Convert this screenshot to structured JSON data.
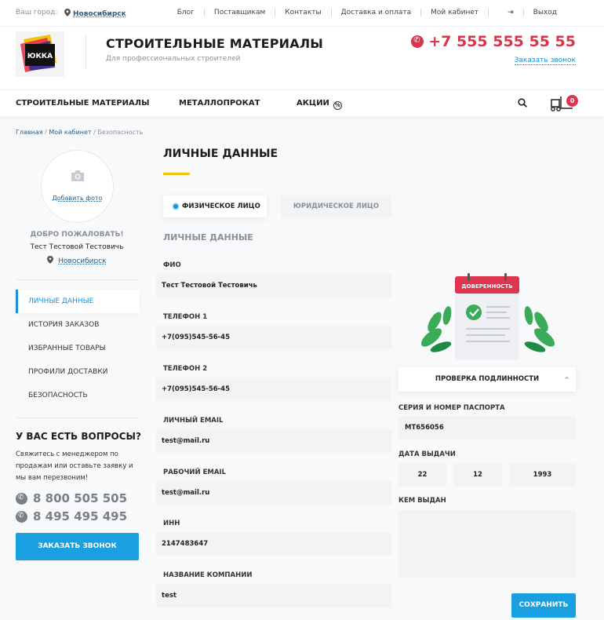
{
  "topbar": {
    "city_label": "Ваш город:",
    "city": "Новосибирск",
    "links": [
      "Блог",
      "Поставщикам",
      "Контакты",
      "Доставка и оплата",
      "Мой кабинет"
    ],
    "logout": "Выход"
  },
  "header": {
    "logo_text": "ЮККА",
    "title": "СТРОИТЕЛЬНЫЕ МАТЕРИАЛЫ",
    "subtitle": "Для профессиональных строителей",
    "phone": "+7 555 555 55 55",
    "callback_link": "Заказать звонок"
  },
  "nav": {
    "items": [
      "СТРОИТЕЛЬНЫЕ МАТЕРИАЛЫ",
      "МЕТАЛЛОПРОКАТ",
      "АКЦИИ"
    ],
    "promo_badge": "%",
    "cart_count": "0"
  },
  "breadcrumb": {
    "home": "Главная",
    "cabinet": "Мой кабинет",
    "current": "Безопасность",
    "sep": "/"
  },
  "sidebar": {
    "add_photo": "Добавить фото",
    "welcome": "ДОБРО ПОЖАЛОВАТЬ!",
    "username": "Тест Тестовой Тестовичь",
    "city": "Новосибирск",
    "menu": [
      "ЛИЧНЫЕ ДАННЫЕ",
      "ИСТОРИЯ ЗАКАЗОВ",
      "ИЗБРАННЫЕ ТОВАРЫ",
      "ПРОФИЛИ ДОСТАВКИ",
      "БЕЗОПАСНОСТЬ"
    ],
    "questions_title": "У ВАС ЕСТЬ ВОПРОСЫ?",
    "questions_text": "Свяжитесь с менеджером по продажам или оставьте заявку и мы вам перезвоним!",
    "phones": [
      "8 800 505 505",
      "8 495 495 495"
    ],
    "callback_button": "ЗАКАЗАТЬ ЗВОНОК"
  },
  "main": {
    "title": "ЛИЧНЫЕ ДАННЫЕ",
    "tabs": [
      "ФИЗИЧЕСКОЕ ЛИЦО",
      "ЮРИДИЧЕСКОЕ ЛИЦО"
    ],
    "section_title": "ЛИЧНЫЕ ДАННЫЕ",
    "fields": [
      {
        "label": "ФИО",
        "value": "Тест Тестовой Тестовичь"
      },
      {
        "label": "ТЕЛЕФОН 1",
        "value": "+7(095)545-56-45"
      },
      {
        "label": "ТЕЛЕФОН 2",
        "value": "+7(095)545-56-45"
      },
      {
        "label": "ЛИЧНЫЙ EMAIL",
        "value": "test@mail.ru"
      },
      {
        "label": "РАБОЧИЙ EMAIL",
        "value": "test@mail.ru"
      },
      {
        "label": "ИНН",
        "value": "2147483647"
      },
      {
        "label": "НАЗВАНИЕ КОМПАНИИ",
        "value": "test"
      }
    ]
  },
  "passport": {
    "illustration_label": "ДОВЕРЕННОСТЬ",
    "verify_button": "ПРОВЕРКА ПОДЛИННОСТИ",
    "series_label": "СЕРИЯ И НОМЕР ПАСПОРТА",
    "series_value": "MT656056",
    "date_label": "ДАТА ВЫДАЧИ",
    "date_day": "22",
    "date_month": "12",
    "date_year": "1993",
    "issued_label": "КЕМ ВЫДАН",
    "issued_value": "",
    "save_button": "СОХРАНИТЬ"
  },
  "colors": {
    "accent": "#1a9fe0",
    "phone_red": "#d8344a",
    "underline_yellow": "#f2c40c"
  }
}
